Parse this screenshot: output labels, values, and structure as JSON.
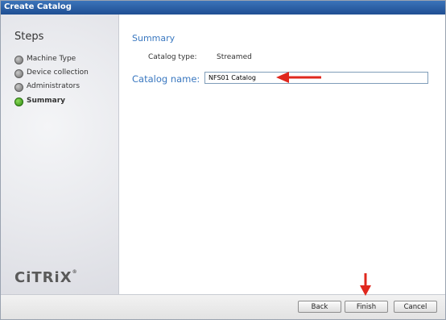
{
  "window": {
    "title": "Create Catalog"
  },
  "sidebar": {
    "title": "Steps",
    "steps": [
      {
        "label": "Machine Type",
        "state": "done"
      },
      {
        "label": "Device collection",
        "state": "done"
      },
      {
        "label": "Administrators",
        "state": "done"
      },
      {
        "label": "Summary",
        "state": "active"
      }
    ],
    "logo": "CiTRiX",
    "logo_mark": "®"
  },
  "main": {
    "section_title": "Summary",
    "catalog_type_label": "Catalog type:",
    "catalog_type_value": "Streamed",
    "catalog_name_label": "Catalog name:",
    "catalog_name_value": "NFS01 Catalog"
  },
  "footer": {
    "back_label": "Back",
    "finish_label": "Finish",
    "cancel_label": "Cancel"
  },
  "colors": {
    "accent": "#3a78c0",
    "titlebar": "#2a5ea6",
    "annotation_arrow": "#e0281e",
    "active_step": "#3aa11a"
  },
  "icons": {
    "step_done": "gray-circle-icon",
    "step_active": "green-circle-icon",
    "annotation": "red-arrow-icon"
  }
}
